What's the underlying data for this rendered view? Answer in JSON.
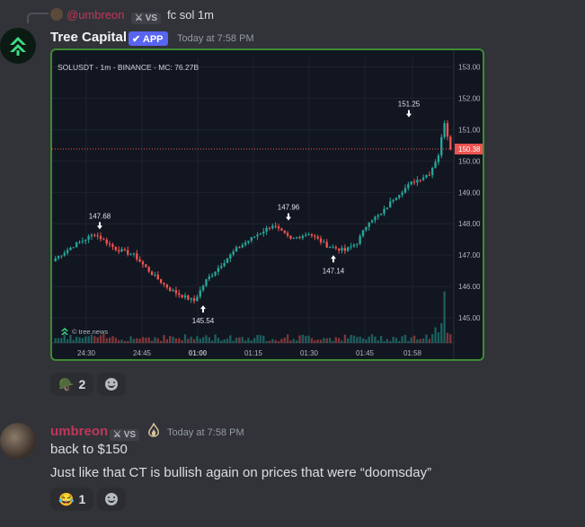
{
  "reply": {
    "username": "@umbreon",
    "tag": "VS",
    "text": "fc sol 1m"
  },
  "bot_message": {
    "name": "Tree Capital",
    "badge": "APP",
    "timestamp": "Today at 7:58 PM",
    "reactions": [
      {
        "emoji": "🪖",
        "count": "2"
      }
    ]
  },
  "chart_data": {
    "type": "candlestick",
    "title": "SOLUSDT - 1m - BINANCE - MC: 76.27B",
    "watermark": "tree.news",
    "current_price": "150.38",
    "y_ticks": [
      "153.00",
      "152.00",
      "151.00",
      "150.00",
      "149.00",
      "148.00",
      "147.00",
      "146.00",
      "145.00"
    ],
    "ylim": [
      144.2,
      153.3
    ],
    "x_ticks": [
      "24:30",
      "24:45",
      "01:00",
      "01:15",
      "01:30",
      "01:45",
      "01:58"
    ],
    "annotations": [
      {
        "label": "147.68",
        "value": 147.68,
        "kind": "high"
      },
      {
        "label": "145.54",
        "value": 145.54,
        "kind": "low"
      },
      {
        "label": "147.96",
        "value": 147.96,
        "kind": "high"
      },
      {
        "label": "147.14",
        "value": 147.14,
        "kind": "low"
      },
      {
        "label": "151.25",
        "value": 151.25,
        "kind": "high"
      }
    ],
    "colors": {
      "up": "#26a69a",
      "down": "#ef5350",
      "background": "#121620",
      "grid": "#1e2330",
      "price_line": "#ef5350"
    }
  },
  "user_message": {
    "username": "umbreon",
    "tag": "VS",
    "timestamp": "Today at 7:58 PM",
    "lines": [
      "back to $150",
      "Just like that CT is bullish again on prices that were “doomsday”"
    ],
    "reactions": [
      {
        "emoji": "😂",
        "count": "1"
      }
    ]
  },
  "icons": {
    "bot_avatar": "tree-capital-logo-icon",
    "add_reaction": "add-reaction-smile-icon",
    "tag_icon": "sword-icon",
    "user_badge": "flame-badge-icon"
  }
}
